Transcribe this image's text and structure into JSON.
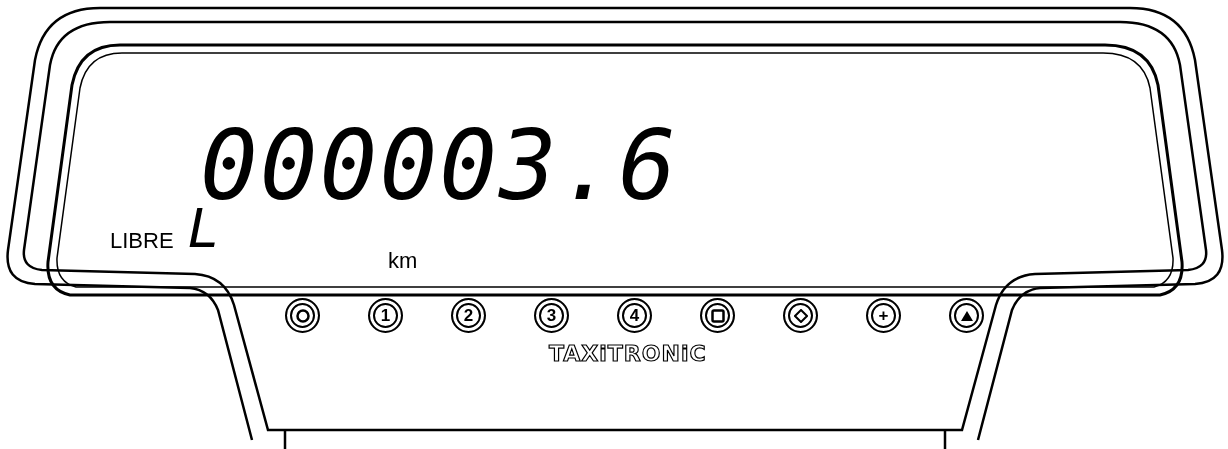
{
  "display": {
    "reading": "000003.6",
    "tariff": "L",
    "status": "LIBRE",
    "unit": "km"
  },
  "buttons": [
    {
      "kind": "circle"
    },
    {
      "kind": "label",
      "label": "1"
    },
    {
      "kind": "label",
      "label": "2"
    },
    {
      "kind": "label",
      "label": "3"
    },
    {
      "kind": "label",
      "label": "4"
    },
    {
      "kind": "square"
    },
    {
      "kind": "diamond"
    },
    {
      "kind": "label",
      "label": "+"
    },
    {
      "kind": "triangle"
    }
  ],
  "brand": "TAXiTRONiC"
}
